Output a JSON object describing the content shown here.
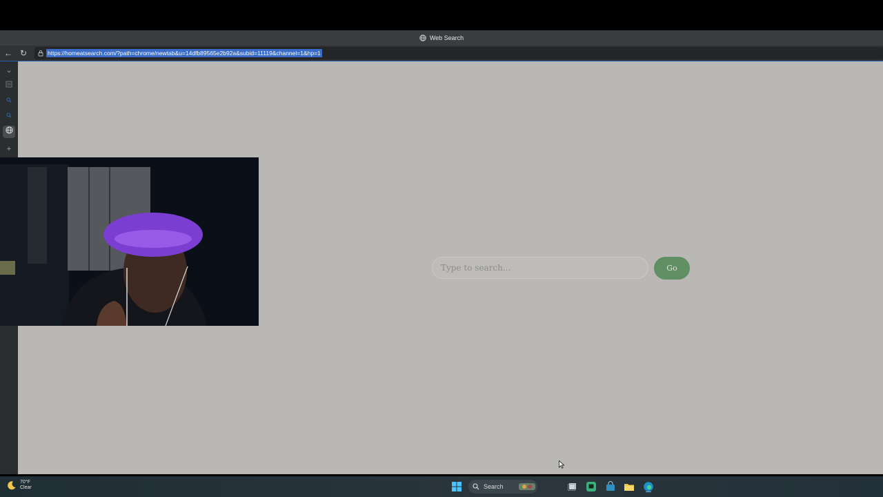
{
  "window": {
    "title": "Web Search"
  },
  "browser": {
    "url": "https://homeatsearch.com/?path=chrome/newtab&u=14dfb89565e2b92a&subid=11119&channel=1&hp=1"
  },
  "page": {
    "search_placeholder": "Type to search...",
    "go_label": "Go"
  },
  "taskbar": {
    "weather_temp": "70°F",
    "weather_desc": "Clear",
    "search_label": "Search"
  },
  "colors": {
    "page_background": "#b9b8b4",
    "go_button": "#5f8f63",
    "url_highlight": "#3a6cc8"
  }
}
